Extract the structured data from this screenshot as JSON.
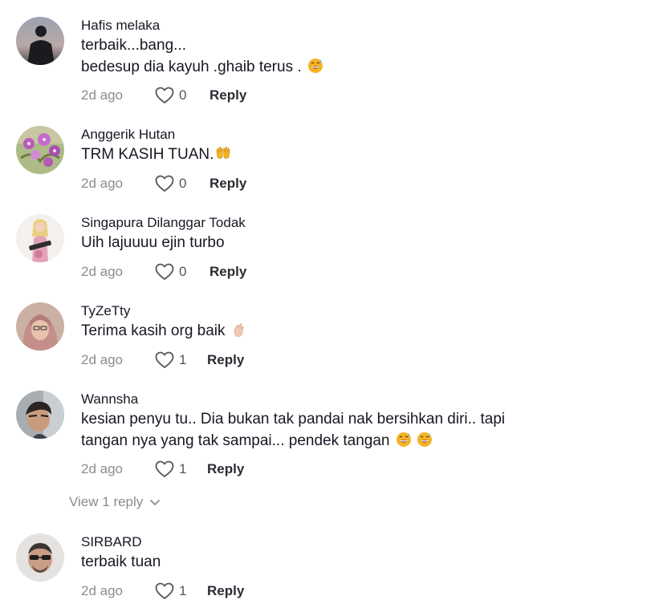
{
  "comments": [
    {
      "username": "Hafis melaka",
      "lines": [
        "terbaik...bang...",
        "bedesup dia kayuh .ghaib terus . "
      ],
      "time": "2d ago",
      "likes": "0",
      "reply_label": "Reply",
      "emoji": [
        "sweat-smile"
      ]
    },
    {
      "username": "Anggerik Hutan",
      "lines": [
        "TRM KASIH TUAN."
      ],
      "time": "2d ago",
      "likes": "0",
      "reply_label": "Reply",
      "emoji": [
        "open-hands"
      ]
    },
    {
      "username": "Singapura Dilanggar Todak",
      "lines": [
        "Uih lajuuuu ejin turbo"
      ],
      "time": "2d ago",
      "likes": "0",
      "reply_label": "Reply"
    },
    {
      "username": "TyZeTty",
      "lines": [
        "Terima kasih org baik "
      ],
      "time": "2d ago",
      "likes": "1",
      "reply_label": "Reply",
      "emoji": [
        "hand-gesture"
      ]
    },
    {
      "username": "Wannsha",
      "lines": [
        "kesian penyu tu.. Dia bukan tak pandai nak bersihkan diri.. tapi",
        "tangan nya yang tak sampai... pendek tangan "
      ],
      "time": "2d ago",
      "likes": "1",
      "reply_label": "Reply",
      "emoji": [
        "sweat-smile",
        "sweat-smile"
      ]
    },
    {
      "username": "SIRBARD",
      "lines": [
        "terbaik tuan"
      ],
      "time": "2d ago",
      "likes": "1",
      "reply_label": "Reply"
    }
  ],
  "view_replies_label": "View 1 reply",
  "colors": {
    "text": "#161823",
    "muted": "#8a8b91",
    "reply": "#2b2c33"
  },
  "icons": [
    "heart-outline-icon",
    "chevron-down-icon",
    "sweat-smile-emoji",
    "open-hands-emoji",
    "hand-gesture-emoji"
  ]
}
